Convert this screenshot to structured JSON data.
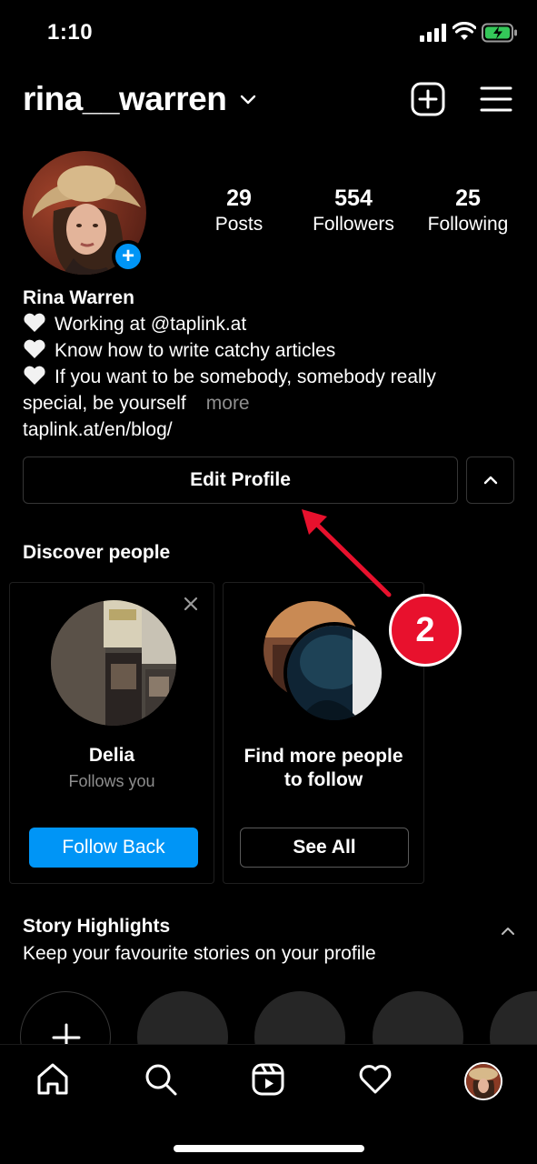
{
  "status": {
    "time": "1:10"
  },
  "header": {
    "username": "rina__warren"
  },
  "profile": {
    "stats": [
      {
        "value": "29",
        "label": "Posts"
      },
      {
        "value": "554",
        "label": "Followers"
      },
      {
        "value": "25",
        "label": "Following"
      }
    ],
    "name": "Rina Warren",
    "bio_lines": [
      "Working at @taplink.at",
      "Know how to write catchy articles",
      "If you want to be somebody, somebody really"
    ],
    "bio_cont": "special, be yourself",
    "more": "more",
    "link": "taplink.at/en/blog/",
    "edit_button": "Edit Profile"
  },
  "discover": {
    "title": "Discover people",
    "card1": {
      "name": "Delia",
      "subtitle": "Follows you",
      "button": "Follow Back"
    },
    "card2": {
      "title_line1": "Find more people",
      "title_line2": "to follow",
      "button": "See All"
    }
  },
  "annotation": {
    "number": "2",
    "color": "#e8112d"
  },
  "highlights": {
    "title": "Story Highlights",
    "subtitle": "Keep your favourite stories on your profile"
  },
  "colors": {
    "accent": "#0095f6",
    "muted": "#8e8e8e",
    "background": "#000000"
  },
  "nav": {
    "items": [
      "home-icon",
      "search-icon",
      "reels-icon",
      "heart-icon",
      "profile-avatar"
    ]
  }
}
